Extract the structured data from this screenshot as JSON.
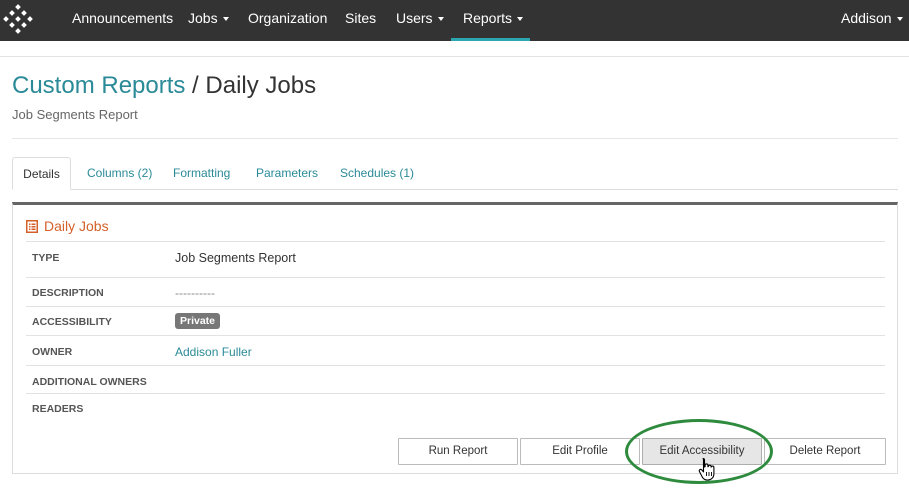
{
  "nav": {
    "items": [
      {
        "label": "Announcements",
        "has_caret": false
      },
      {
        "label": "Jobs",
        "has_caret": true
      },
      {
        "label": "Organization",
        "has_caret": false
      },
      {
        "label": "Sites",
        "has_caret": false
      },
      {
        "label": "Users",
        "has_caret": true
      },
      {
        "label": "Reports",
        "has_caret": true,
        "active": true
      }
    ],
    "user": "Addison",
    "accent": "#2aa7b1"
  },
  "page": {
    "breadcrumb_link": "Custom Reports",
    "separator": " / ",
    "title": "Daily Jobs",
    "subtitle": "Job Segments Report"
  },
  "tabs": [
    {
      "label": "Details",
      "active": true
    },
    {
      "label": "Columns (2)"
    },
    {
      "label": "Formatting"
    },
    {
      "label": "Parameters"
    },
    {
      "label": "Schedules (1)"
    }
  ],
  "panel": {
    "title": "Daily Jobs",
    "icon": "list-report-icon",
    "rows": [
      {
        "label": "TYPE",
        "value": "Job Segments Report"
      },
      {
        "label": "DESCRIPTION",
        "value": "----------"
      },
      {
        "label": "ACCESSIBILITY",
        "value": "Private"
      },
      {
        "label": "OWNER",
        "value": "Addison Fuller"
      },
      {
        "label": "ADDITIONAL OWNERS",
        "value": ""
      },
      {
        "label": "READERS",
        "value": ""
      }
    ]
  },
  "actions": {
    "run": "Run Report",
    "edit_profile": "Edit Profile",
    "edit_accessibility": "Edit Accessibility",
    "delete": "Delete Report"
  },
  "colors": {
    "link": "#2a8a97",
    "panel_title": "#d5602a",
    "highlight": "#2e8b3e",
    "badge": "#777777"
  }
}
